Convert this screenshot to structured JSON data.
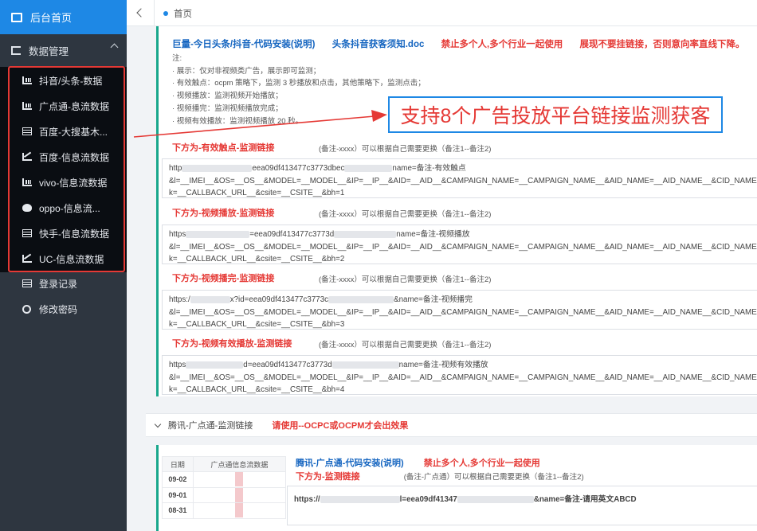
{
  "sidebar": {
    "home_label": "后台首页",
    "group_label": "数据管理",
    "items": [
      {
        "label": "抖音/头条-数据",
        "icon": "bar-chart-icon"
      },
      {
        "label": "广点通-息流数据",
        "icon": "bar-chart-icon"
      },
      {
        "label": "百度-大搜基木...",
        "icon": "table-icon"
      },
      {
        "label": "百度-信息流数据",
        "icon": "line-chart-icon"
      },
      {
        "label": "vivo-信息流数据",
        "icon": "bar-chart-icon"
      },
      {
        "label": "oppo-信息流...",
        "icon": "area-chart-icon"
      },
      {
        "label": "快手-信息流数据",
        "icon": "table-icon"
      },
      {
        "label": "UC-信息流数据",
        "icon": "line-chart-icon"
      }
    ],
    "login_records_label": "登录记录",
    "change_password_label": "修改密码"
  },
  "topbar": {
    "tab_label": "首页"
  },
  "card1": {
    "header": {
      "code_install": "巨量-今日头条/抖音-代码安装(说明)",
      "doc": "头条抖音获客须知.doc",
      "warn1": "禁止多个人,多个行业一起使用",
      "warn2": "展现不要挂链接，否则意向率直线下降。"
    },
    "notes": [
      "注:",
      "· 展示：仅对非视频类广告，展示即可监测；",
      "· 有效触点：ocpm 策略下，监测 3 秒播放和点击，其他策略下，监测点击；",
      "· 视频播放：监测视频开始播放；",
      "· 视频播完：监测视频播放完成；",
      "· 视频有效播放：监测视频播放 20 秒。"
    ],
    "callout": "支持8个广告投放平台链接监测获客",
    "sections": [
      {
        "title": "下方为-有效触点-监测链接",
        "note": "(备注-xxxx）可以根据自己需要更换（备注1--备注2)",
        "line1_a": "http",
        "line1_b": "eea09df413477c3773dbec",
        "line1_c": "name=备注-有效触点",
        "line2": "&l=__IMEI__&OS=__OS__&MODEL=__MODEL__&IP=__IP__&AID=__AID__&CAMPAIGN_NAME=__CAMPAIGN_NAME__&AID_NAME=__AID_NAME__&CID_NAME=__C",
        "line3": "k=__CALLBACK_URL__&csite=__CSITE__&bh=1"
      },
      {
        "title": "下方为-视频播放-监测链接",
        "note": "(备注-xxxx）可以根据自己需要更换（备注1--备注2)",
        "line1_a": "https",
        "line1_b": "=eea09df413477c3773d",
        "line1_c": "name=备注-视频播放",
        "line2": "&l=__IMEI__&OS=__OS__&MODEL=__MODEL__&IP=__IP__&AID=__AID__&CAMPAIGN_NAME=__CAMPAIGN_NAME__&AID_NAME=__AID_NAME__&CID_NAME=__C",
        "line3": "k=__CALLBACK_URL__&csite=__CSITE__&bh=2"
      },
      {
        "title": "下方为-视频播完-监测链接",
        "note": "(备注-xxxx）可以根据自己需要更换（备注1--备注2)",
        "line1_a": "https:/",
        "line1_b": "x?id=eea09df413477c3773c",
        "line1_c": "&name=备注-视频播完",
        "line2": "&l=__IMEI__&OS=__OS__&MODEL=__MODEL__&IP=__IP__&AID=__AID__&CAMPAIGN_NAME=__CAMPAIGN_NAME__&AID_NAME=__AID_NAME__&CID_NAME=__C",
        "line3": "k=__CALLBACK_URL__&csite=__CSITE__&bh=3"
      },
      {
        "title": "下方为-视频有效播放-监测链接",
        "note": "(备注-xxxx）可以根据自己需要更换（备注1--备注2)",
        "line1_a": "https",
        "line1_b": "d=eea09df413477c3773d",
        "line1_c": "name=备注-视频有效播放",
        "line2": "&l=__IMEI__&OS=__OS__&MODEL=__MODEL__&IP=__IP__&AID=__AID__&CAMPAIGN_NAME=__CAMPAIGN_NAME__&AID_NAME=__AID_NAME__&CID_NAME=__C",
        "line3": "k=__CALLBACK_URL__&csite=__CSITE__&bh=4"
      }
    ]
  },
  "tencent": {
    "collapse_label": "腾讯-广点通-监测链接",
    "warn": "请使用--OCPC或OCPM才会出效果",
    "table": {
      "headers": [
        "日期",
        "广点通信息流数据"
      ],
      "dates": [
        "09-02",
        "09-01",
        "08-31"
      ]
    },
    "header_code": "腾讯-广点通-代码安装(说明)",
    "header_warn": "禁止多个人,多个行业一起使用",
    "sub_title": "下方为-监测链接",
    "sub_note": "(备注-广点通）可以根据自己需要更换（备注1--备注2)",
    "url_a": "https://",
    "url_b": "l=eea09df41347",
    "url_c": "&name=备注-请用英文ABCD"
  },
  "colors": {
    "sidebar_bg": "#2e3640",
    "active_blue": "#1e88e5",
    "accent_teal": "#19a78c",
    "warn_red": "#e53935"
  }
}
